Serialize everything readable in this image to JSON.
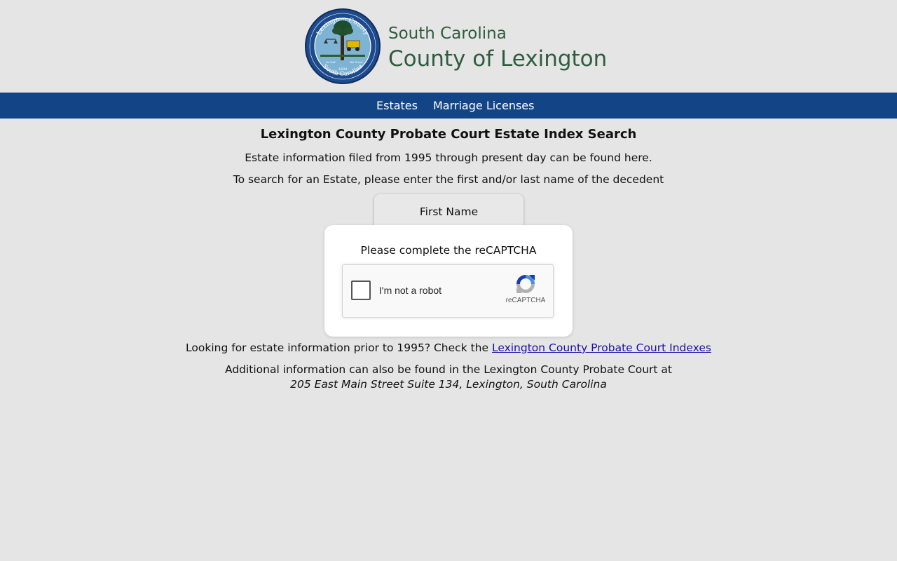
{
  "header": {
    "seal_top_text": "Lexington County",
    "seal_bottom_text": "South Carolina",
    "seal_motto_left": "In God",
    "seal_motto_right": "We Trust",
    "seal_year": "1804",
    "state": "South Carolina",
    "county": "County of Lexington",
    "text_color": "#2f5c3f"
  },
  "nav": {
    "background": "#134586",
    "items": [
      {
        "label": "Estates"
      },
      {
        "label": "Marriage Licenses"
      }
    ]
  },
  "main": {
    "title": "Lexington County Probate Court Estate Index Search",
    "intro": "Estate information filed from 1995 through present day can be found here.",
    "instructions": "To search for an Estate, please enter the first and/or last name of the decedent",
    "first_name_label": "First Name"
  },
  "captcha": {
    "prompt": "Please complete the reCAPTCHA",
    "checkbox_label": "I'm not a robot",
    "brand": "reCAPTCHA",
    "checked": false
  },
  "footer": {
    "prior_text": "Looking for estate information prior to 1995? Check the ",
    "prior_link": "Lexington County Probate Court Indexes",
    "additional": "Additional information can also be found in the Lexington County Probate Court at",
    "address": "205 East Main Street Suite 134, Lexington, South Carolina"
  }
}
